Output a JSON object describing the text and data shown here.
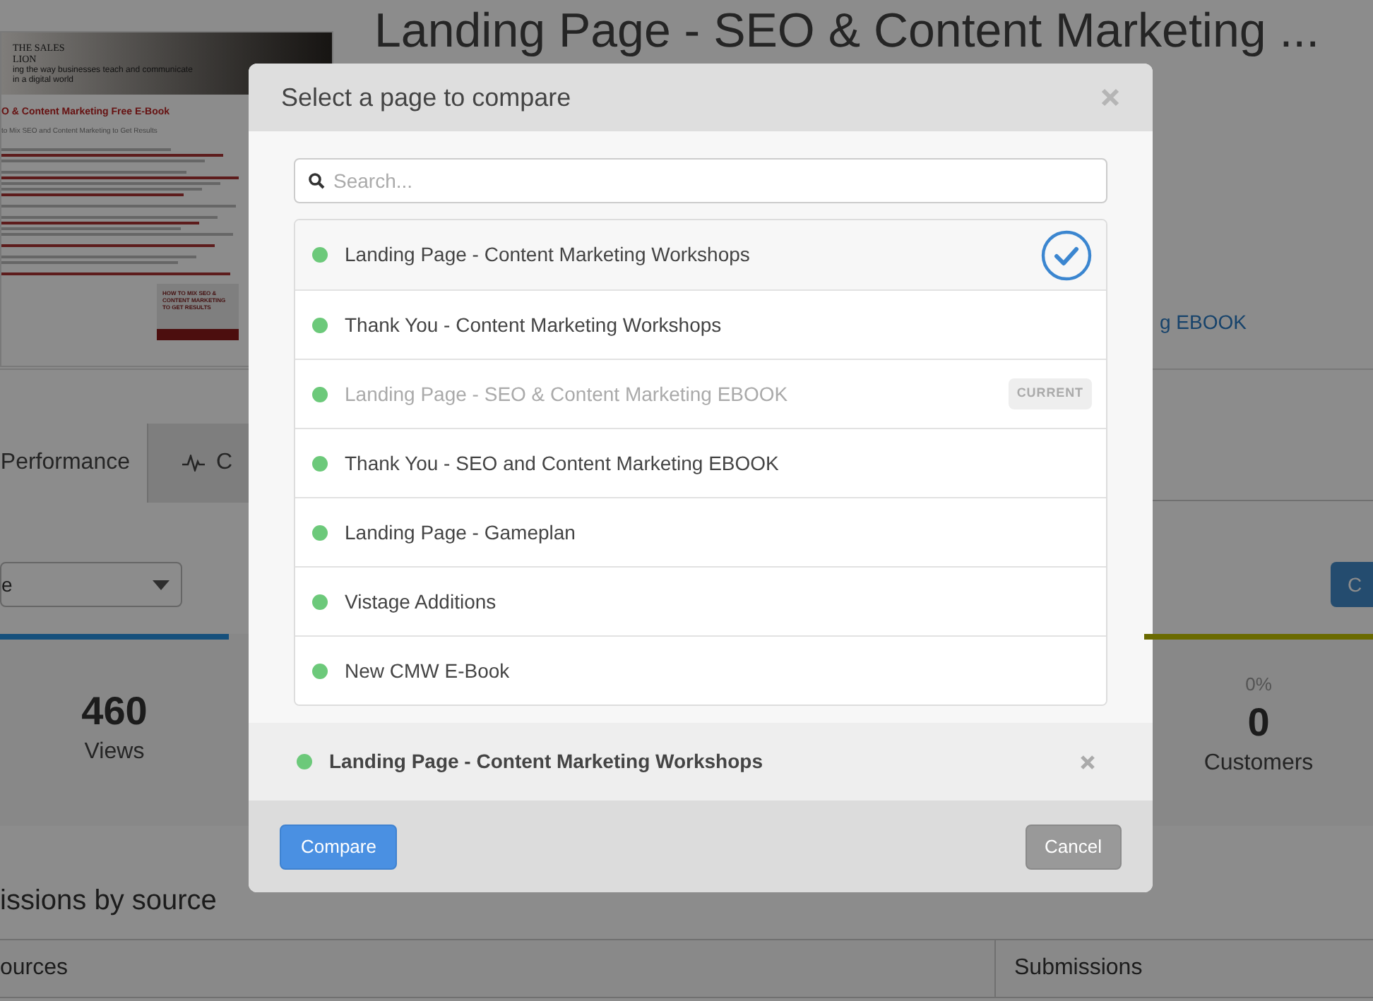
{
  "page": {
    "thumbnail": {
      "brand": "THE SALES LION",
      "tagline": "ing the way businesses teach and communicate in a digital world",
      "heading": "O & Content Marketing Free E-Book",
      "subheading": "to Mix SEO and Content Marketing to Get Results",
      "book_title": "HOW TO MIX SEO & CONTENT MARKETING TO GET RESULTS"
    },
    "title": "Landing Page - SEO & Content Marketing ...",
    "link": "g EBOOK",
    "tabs": [
      {
        "label": "Performance",
        "selected": true
      },
      {
        "label": "C",
        "selected": false
      }
    ],
    "dropdown": {
      "value": "e"
    },
    "action_button": "C",
    "stats": [
      {
        "value": "460",
        "label": "Views",
        "color": "#16507c"
      },
      {
        "percent": "0%",
        "value": "0",
        "label": "Customers",
        "color": "#6a6a00"
      }
    ],
    "section_title": "issions by source",
    "table": {
      "columns": [
        "ources",
        "Submissions"
      ]
    }
  },
  "modal": {
    "title": "Select a page to compare",
    "search": {
      "placeholder": "Search..."
    },
    "pages": [
      {
        "name": "Landing Page - Content Marketing Workshops",
        "selected": true,
        "disabled": false
      },
      {
        "name": "Thank You - Content Marketing Workshops",
        "selected": false,
        "disabled": false
      },
      {
        "name": "Landing Page - SEO & Content Marketing EBOOK",
        "selected": false,
        "disabled": true,
        "badge": "CURRENT"
      },
      {
        "name": "Thank You - SEO and Content Marketing EBOOK",
        "selected": false,
        "disabled": false
      },
      {
        "name": "Landing Page - Gameplan",
        "selected": false,
        "disabled": false
      },
      {
        "name": "Vistage Additions",
        "selected": false,
        "disabled": false
      },
      {
        "name": "New CMW E-Book",
        "selected": false,
        "disabled": false
      }
    ],
    "selection": {
      "name": "Landing Page - Content Marketing Workshops"
    },
    "buttons": {
      "compare": "Compare",
      "cancel": "Cancel"
    }
  }
}
